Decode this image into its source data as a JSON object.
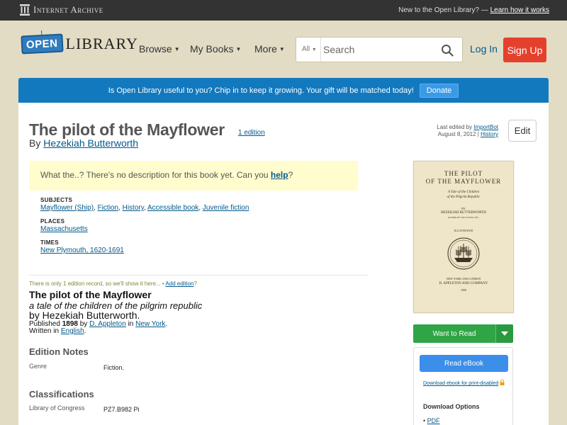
{
  "ia_bar": {
    "logo_text": "Internet Archive",
    "new_text": "New to the Open Library? —",
    "learn_link": "Learn how it works"
  },
  "header": {
    "logo_badge": "OPEN",
    "logo_text": "LIBRARY",
    "nav": {
      "browse": "Browse",
      "my_books": "My Books",
      "more": "More"
    },
    "search": {
      "scope": "All",
      "placeholder": "Search"
    },
    "login": "Log In",
    "signup": "Sign Up"
  },
  "donate": {
    "text": "Is Open Library useful to you? Chip in to keep it growing. Your gift will be matched today!",
    "button": "Donate"
  },
  "book": {
    "title": "The pilot of the Mayflower",
    "edition_count": "1 edition",
    "by_prefix": "By",
    "author": "Hezekiah Butterworth",
    "last_edited_prefix": "Last edited by",
    "last_edited_by": "ImportBot",
    "last_edited_date": "August 8, 2012 |",
    "history": "History",
    "edit": "Edit",
    "no_description": "What the..? There's no description for this book yet. Can you",
    "help": "help",
    "help_suffix": "?"
  },
  "meta": {
    "subjects_label": "SUBJECTS",
    "subjects": [
      "Mayflower (Ship)",
      "Fiction",
      "History",
      "Accessible book",
      "Juvenile fiction"
    ],
    "places_label": "PLACES",
    "places": [
      "Massachusetts"
    ],
    "times_label": "TIMES",
    "times": [
      "New Plymouth, 1620-1691"
    ]
  },
  "edition": {
    "note": "There is only 1 edition record, so we'll show it here...  •",
    "add_edition": "Add edition",
    "add_suffix": "?",
    "title": "The pilot of the Mayflower",
    "subtitle": "a tale of the children of the pilgrim republic",
    "by": "by Hezekiah Butterworth.",
    "published_prefix": "Published",
    "year": "1898",
    "by_word": "by",
    "publisher": "D. Appleton",
    "in_word": "in",
    "place": "New York",
    "period": ".",
    "written_prefix": "Written in",
    "language": "English",
    "language_suffix": "."
  },
  "edition_notes": {
    "heading": "Edition Notes",
    "genre_label": "Genre",
    "genre_value": "Fiction."
  },
  "classifications": {
    "heading": "Classifications",
    "loc_label": "Library of Congress",
    "loc_value": "PZ7.B982 Pi"
  },
  "cover": {
    "line1": "THE PILOT",
    "line2": "OF THE MAYFLOWER",
    "line3": "A Tale of the Children",
    "line4": "of the Pilgrim Republic",
    "by": "BY",
    "author": "HEZEKIAH BUTTERWORTH",
    "author_note": "AUTHOR OF \"OUT TO SEA\" ETC.",
    "illustrated": "ILLUSTRATED",
    "publisher_place": "NEW YORK AND LONDON",
    "publisher": "D. APPLETON AND COMPANY",
    "year": "1898"
  },
  "sidebar": {
    "want_to_read": "Want to Read",
    "read_ebook": "Read eBook",
    "print_disabled": "Download ebook for print-disabled",
    "download_options": "Download Options",
    "pdf": "PDF"
  }
}
